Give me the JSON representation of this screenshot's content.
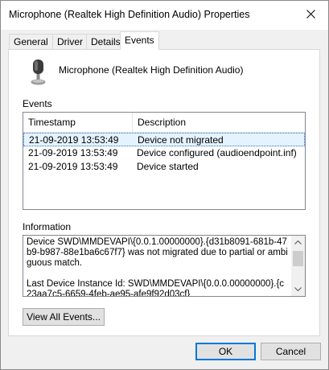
{
  "window": {
    "title": "Microphone (Realtek High Definition Audio) Properties"
  },
  "icons": {
    "close": "close-icon",
    "device": "microphone-icon",
    "scroll_up": "scroll-up-arrow-icon",
    "scroll_down": "scroll-down-arrow-icon"
  },
  "tabs": [
    {
      "label": "General"
    },
    {
      "label": "Driver"
    },
    {
      "label": "Details"
    },
    {
      "label": "Events",
      "active": true
    }
  ],
  "device": {
    "name": "Microphone (Realtek High Definition Audio)"
  },
  "events": {
    "label": "Events",
    "columns": [
      "Timestamp",
      "Description"
    ],
    "rows": [
      {
        "timestamp": "21-09-2019 13:53:49",
        "description": "Device not migrated",
        "selected": true
      },
      {
        "timestamp": "21-09-2019 13:53:49",
        "description": "Device configured (audioendpoint.inf)"
      },
      {
        "timestamp": "21-09-2019 13:53:49",
        "description": "Device started"
      }
    ]
  },
  "information": {
    "label": "Information",
    "paragraph1": "Device SWD\\MMDEVAPI\\{0.0.1.00000000}.{d31b8091-681b-47b9-b987-88e1ba6c67f7} was not migrated due to partial or ambiguous match.",
    "paragraph2": "Last Device Instance Id: SWD\\MMDEVAPI\\{0.0.0.00000000}.{c23aa7c5-6659-4feb-ae95-afe9f92d03cf}"
  },
  "buttons": {
    "view_all": "View All Events...",
    "ok": "OK",
    "cancel": "Cancel"
  },
  "colors": {
    "selection_bg": "#e5f3ff",
    "focus_border": "#0078d7"
  }
}
